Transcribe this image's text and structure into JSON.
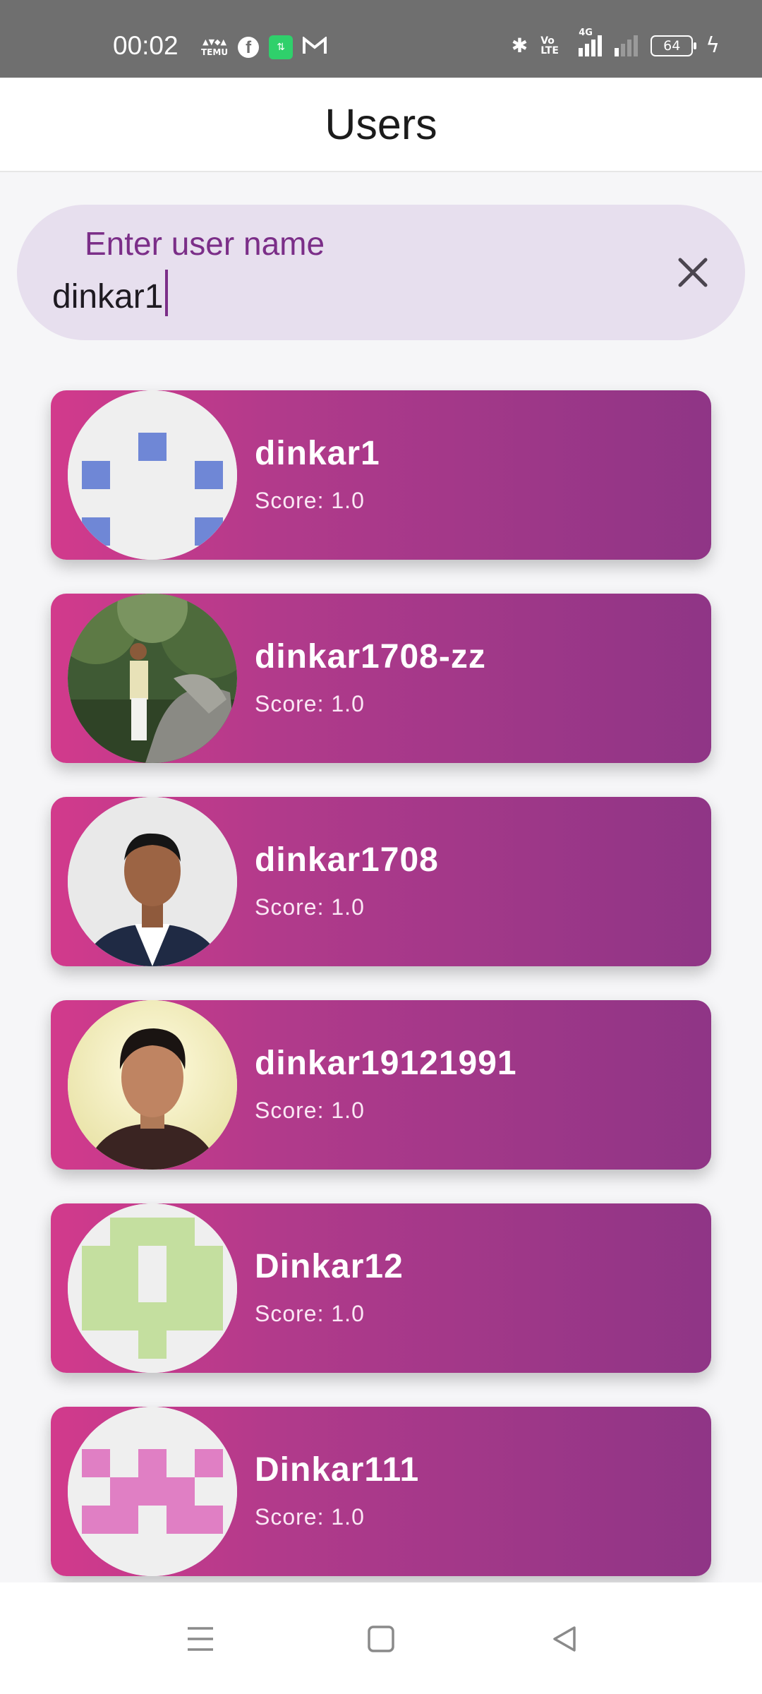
{
  "status_bar": {
    "time": "00:02",
    "left_icons": [
      "temu-icon",
      "facebook-icon",
      "app-icon",
      "gmail-icon"
    ],
    "temu_text": "TEMU",
    "volte_text": "Vo LTE",
    "network_text": "4G",
    "battery": "64"
  },
  "app_bar": {
    "title": "Users"
  },
  "search": {
    "label": "Enter user name",
    "value": "dinkar1"
  },
  "users": [
    {
      "name": "dinkar1",
      "score": "Score: 1.0",
      "avatar": "identicon-blue"
    },
    {
      "name": "dinkar1708-zz",
      "score": "Score: 1.0",
      "avatar": "photo-outdoor"
    },
    {
      "name": "dinkar1708",
      "score": "Score: 1.0",
      "avatar": "photo-portrait"
    },
    {
      "name": "dinkar19121991",
      "score": "Score: 1.0",
      "avatar": "photo-portrait"
    },
    {
      "name": "Dinkar12",
      "score": "Score: 1.0",
      "avatar": "identicon-green"
    },
    {
      "name": "Dinkar111",
      "score": "Score: 1.0",
      "avatar": "identicon-pink"
    }
  ],
  "colors": {
    "card_gradient_start": "#d23a8c",
    "card_gradient_end": "#8f3586",
    "search_bg": "#e7dfee",
    "accent": "#7b2e88"
  },
  "nav": [
    "menu-icon",
    "home-square-icon",
    "back-triangle-icon"
  ]
}
